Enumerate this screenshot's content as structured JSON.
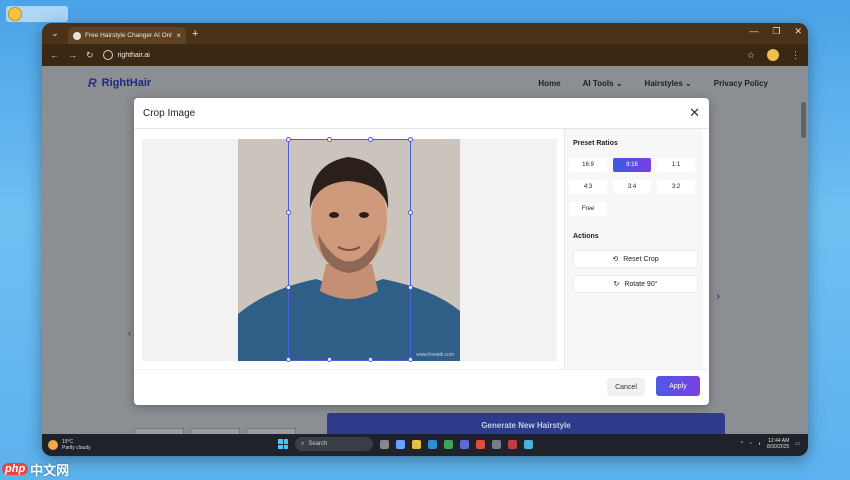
{
  "browser": {
    "tab_title": "Free Hairstyle Changer AI Onl...",
    "url": "righthair.ai"
  },
  "site": {
    "logo_mark": "R",
    "logo_name": "RightHair",
    "nav": [
      "Home",
      "AI Tools",
      "Hairstyles",
      "Privacy Policy"
    ],
    "generate_button": "Generate New Hairstyle"
  },
  "modal": {
    "title": "Crop Image",
    "close_label": "✕",
    "preset_title": "Preset Ratios",
    "ratios": [
      "16:9",
      "9:16",
      "1:1",
      "4:3",
      "3:4",
      "3:2",
      "Free"
    ],
    "active_ratio": "9:16",
    "actions_title": "Actions",
    "reset_label": "Reset Crop",
    "rotate_label": "Rotate 90°",
    "cancel_label": "Cancel",
    "apply_label": "Apply",
    "watermark": "www.freepik.com"
  },
  "taskbar": {
    "weather_temp": "19°C",
    "weather_desc": "Partly cloudy",
    "search_placeholder": "Search",
    "clock_time": "12:44 AM",
    "clock_date": "8/30/2025"
  },
  "overlay_watermark": {
    "badge": "php",
    "text": "中文网"
  }
}
